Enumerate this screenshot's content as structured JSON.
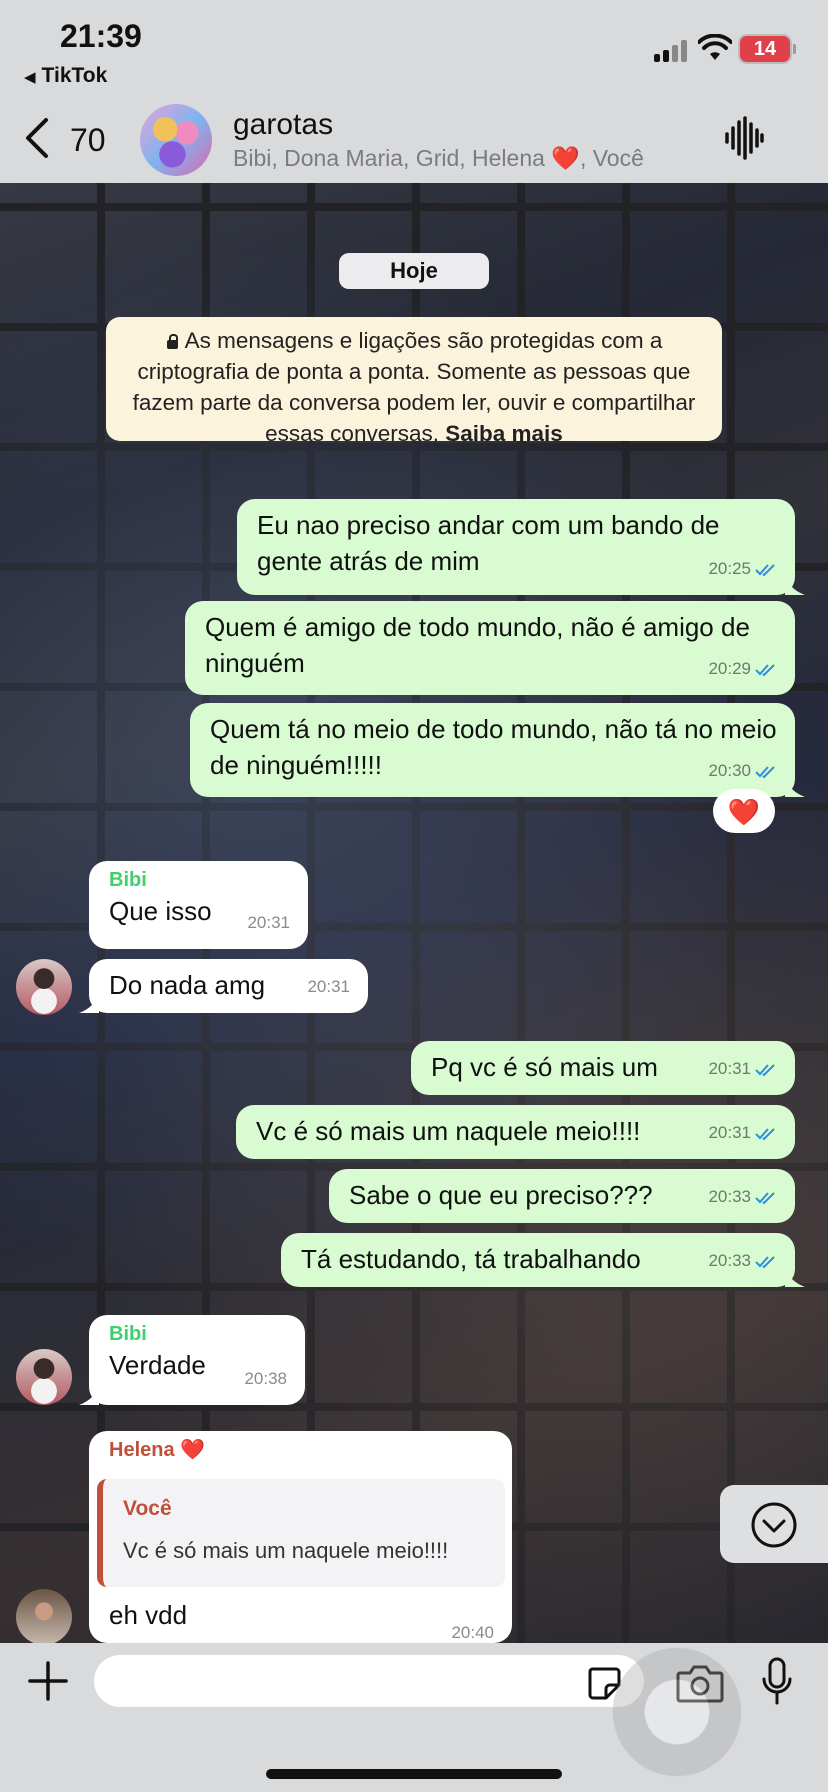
{
  "status_bar": {
    "time": "21:39",
    "back_app": "TikTok",
    "battery": "14"
  },
  "header": {
    "unread_count": "70",
    "group_name": "garotas",
    "members": "Bibi, Dona Maria, Grid, Helena ❤️, Você"
  },
  "chat": {
    "date_label": "Hoje",
    "encryption_notice": "As mensagens e ligações são protegidas com a criptografia de ponta a ponta. Somente as pessoas que fazem parte da conversa podem ler, ouvir e compartilhar essas conversas.",
    "encryption_link": "Saiba mais",
    "messages": [
      {
        "text": "Eu nao preciso andar com um bando de gente atrás de mim",
        "time": "20:25"
      },
      {
        "text": "Quem é amigo de todo mundo, não é amigo de ninguém",
        "time": "20:29"
      },
      {
        "text": "Quem tá no meio de todo mundo, não tá no meio de ninguém!!!!!",
        "time": "20:30",
        "reaction": "❤️"
      },
      {
        "sender": "Bibi",
        "text": "Que isso",
        "time": "20:31"
      },
      {
        "text": "Do nada amg",
        "time": "20:31"
      },
      {
        "text": "Pq vc é só mais um",
        "time": "20:31"
      },
      {
        "text": "Vc é só mais um naquele meio!!!!",
        "time": "20:31"
      },
      {
        "text": "Sabe o que eu preciso???",
        "time": "20:33"
      },
      {
        "text": "Tá estudando, tá trabalhando",
        "time": "20:33"
      },
      {
        "sender": "Bibi",
        "text": "Verdade",
        "time": "20:38"
      },
      {
        "sender": "Helena ❤️",
        "quote_sender": "Você",
        "quote_text": "Vc é só mais um naquele meio!!!!",
        "text": "eh vdd",
        "time": "20:40"
      }
    ]
  },
  "composer": {
    "placeholder": ""
  },
  "colors": {
    "outgoing_bubble": "#d8fbd1",
    "incoming_bubble": "#ffffff",
    "bibi_name": "#3ed06b",
    "helena_name": "#c0503a",
    "read_ticks": "#2a8fe5"
  }
}
